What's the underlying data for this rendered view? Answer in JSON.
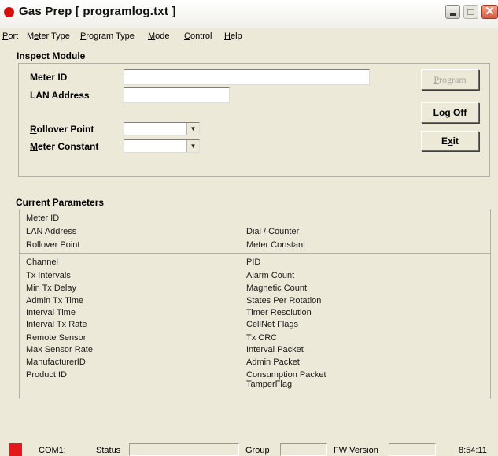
{
  "window": {
    "title": "Gas Prep  [ programlog.txt ]",
    "controls": {
      "minimize": "minimize",
      "maximize": "maximize",
      "close": "✕"
    }
  },
  "menu": [
    "Port",
    "Meter Type",
    "Program Type",
    "Mode",
    "Control",
    "Help"
  ],
  "inspect_module": {
    "title": "Inspect Module",
    "meter_id_label": "Meter ID",
    "meter_id_value": "",
    "lan_address_label": "LAN Address",
    "lan_address_value": "",
    "rollover_point_label": "Rollover Point",
    "rollover_point_value": "",
    "meter_constant_label": "Meter Constant",
    "meter_constant_value": ""
  },
  "buttons": {
    "program": "Program",
    "log_off": "Log Off",
    "exit": "Exit"
  },
  "current_parameters": {
    "title": "Current Parameters",
    "top_left": [
      "Meter ID",
      "LAN Address",
      "Rollover Point"
    ],
    "top_right": [
      "Dial / Counter",
      "Meter Constant"
    ],
    "left": [
      "Channel",
      "Tx Intervals",
      "Min Tx Delay",
      "Admin Tx Time",
      "Interval Time",
      "Interval Tx Rate",
      "Remote Sensor",
      "Max Sensor Rate",
      "ManufacturerID",
      "Product ID"
    ],
    "right": [
      "PID",
      "Alarm Count",
      "Magnetic Count",
      "States Per Rotation",
      "Timer Resolution",
      "CellNet Flags",
      "Tx CRC",
      "Interval Packet",
      "Admin Packet",
      "Consumption Packet",
      "TamperFlag"
    ]
  },
  "statusbar": {
    "port": "COM1:",
    "status": "Status",
    "group": "Group",
    "fw_version": "FW Version",
    "time": "8:54:11"
  },
  "colors": {
    "face": "#ece9d8",
    "red": "#e31818"
  }
}
